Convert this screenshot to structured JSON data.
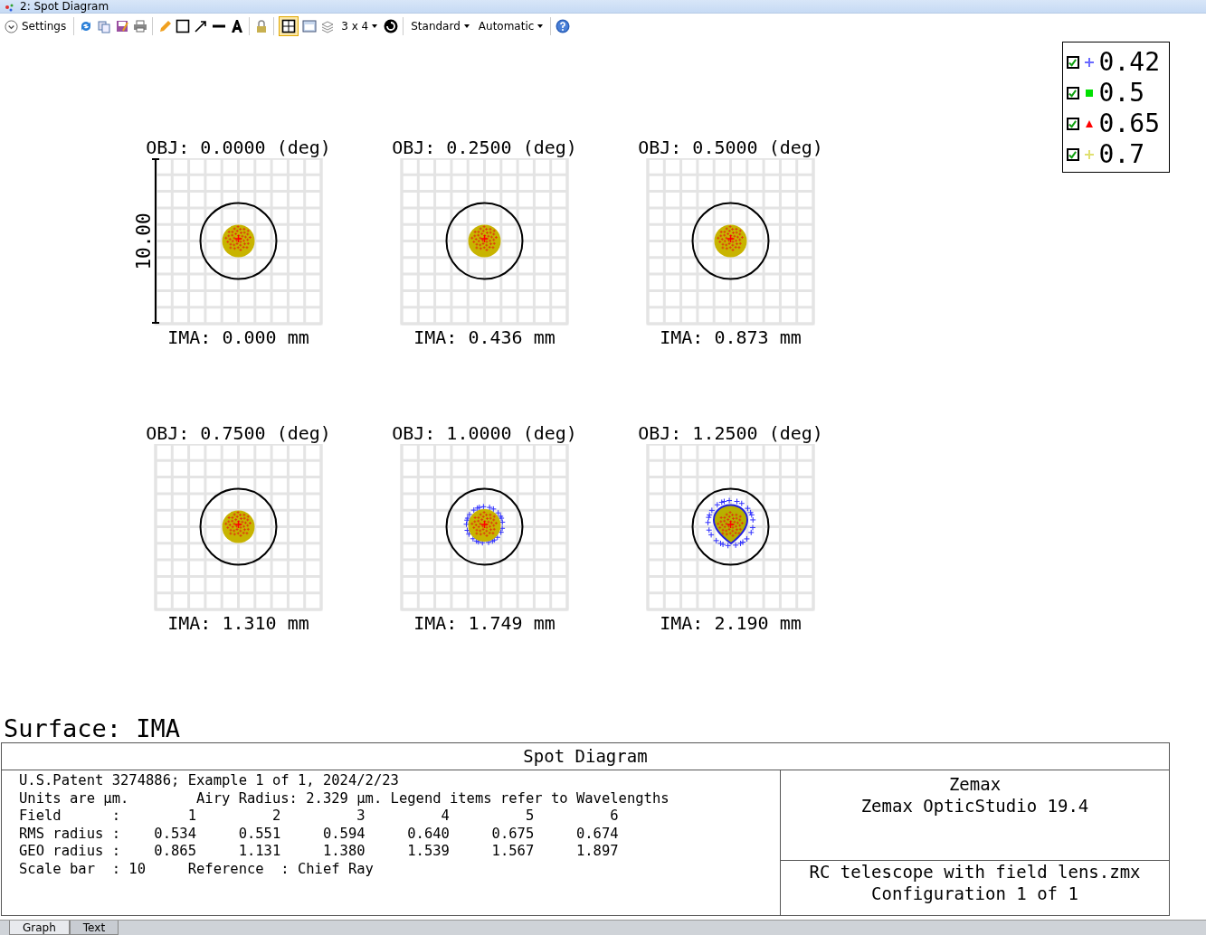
{
  "window": {
    "title": "2: Spot Diagram"
  },
  "toolbar": {
    "settings": "Settings",
    "grid_button": {
      "selected": true
    },
    "layout": "3 x 4",
    "dropdowns": [
      "Standard",
      "Automatic"
    ]
  },
  "plots": [
    {
      "obj": "OBJ: 0.0000 (deg)",
      "ima": "IMA: 0.000 mm",
      "scale_bar": "10.00",
      "kind": "round"
    },
    {
      "obj": "OBJ: 0.2500 (deg)",
      "ima": "IMA: 0.436 mm",
      "kind": "round"
    },
    {
      "obj": "OBJ: 0.5000 (deg)",
      "ima": "IMA: 0.873 mm",
      "kind": "round"
    },
    {
      "obj": "OBJ: 0.7500 (deg)",
      "ima": "IMA: 1.310 mm",
      "kind": "round"
    },
    {
      "obj": "OBJ: 1.0000 (deg)",
      "ima": "IMA: 1.749 mm",
      "kind": "fringe"
    },
    {
      "obj": "OBJ: 1.2500 (deg)",
      "ima": "IMA: 2.190 mm",
      "kind": "teardrop"
    }
  ],
  "legend": [
    {
      "label": "0.42",
      "checked": true,
      "color": "#6a6aff",
      "kind": "plus"
    },
    {
      "label": "0.5",
      "checked": true,
      "color": "#00e000",
      "kind": "square"
    },
    {
      "label": "0.65",
      "checked": true,
      "color": "#ff0000",
      "kind": "triangle"
    },
    {
      "label": "0.7",
      "checked": true,
      "color": "#e0e070",
      "kind": "plus"
    }
  ],
  "surface": "Surface: IMA",
  "table": {
    "title": "Spot Diagram",
    "lines": [
      "U.S.Patent 3274886; Example 1 of 1, 2024/2/23",
      "Units are µm.        Airy Radius: 2.329 µm. Legend items refer to Wavelengths",
      "Field      :        1         2         3         4         5         6",
      "RMS radius :    0.534     0.551     0.594     0.640     0.675     0.674",
      "GEO radius :    0.865     1.131     1.380     1.539     1.567     1.897",
      "Scale bar  : 10     Reference  : Chief Ray"
    ],
    "info_top": [
      "Zemax",
      "Zemax OpticStudio 19.4"
    ],
    "info_bottom": [
      "RC telescope with field lens.zmx",
      "Configuration 1 of 1"
    ]
  },
  "tabs": [
    {
      "label": "Graph",
      "selected": true
    },
    {
      "label": "Text",
      "selected": false
    }
  ]
}
